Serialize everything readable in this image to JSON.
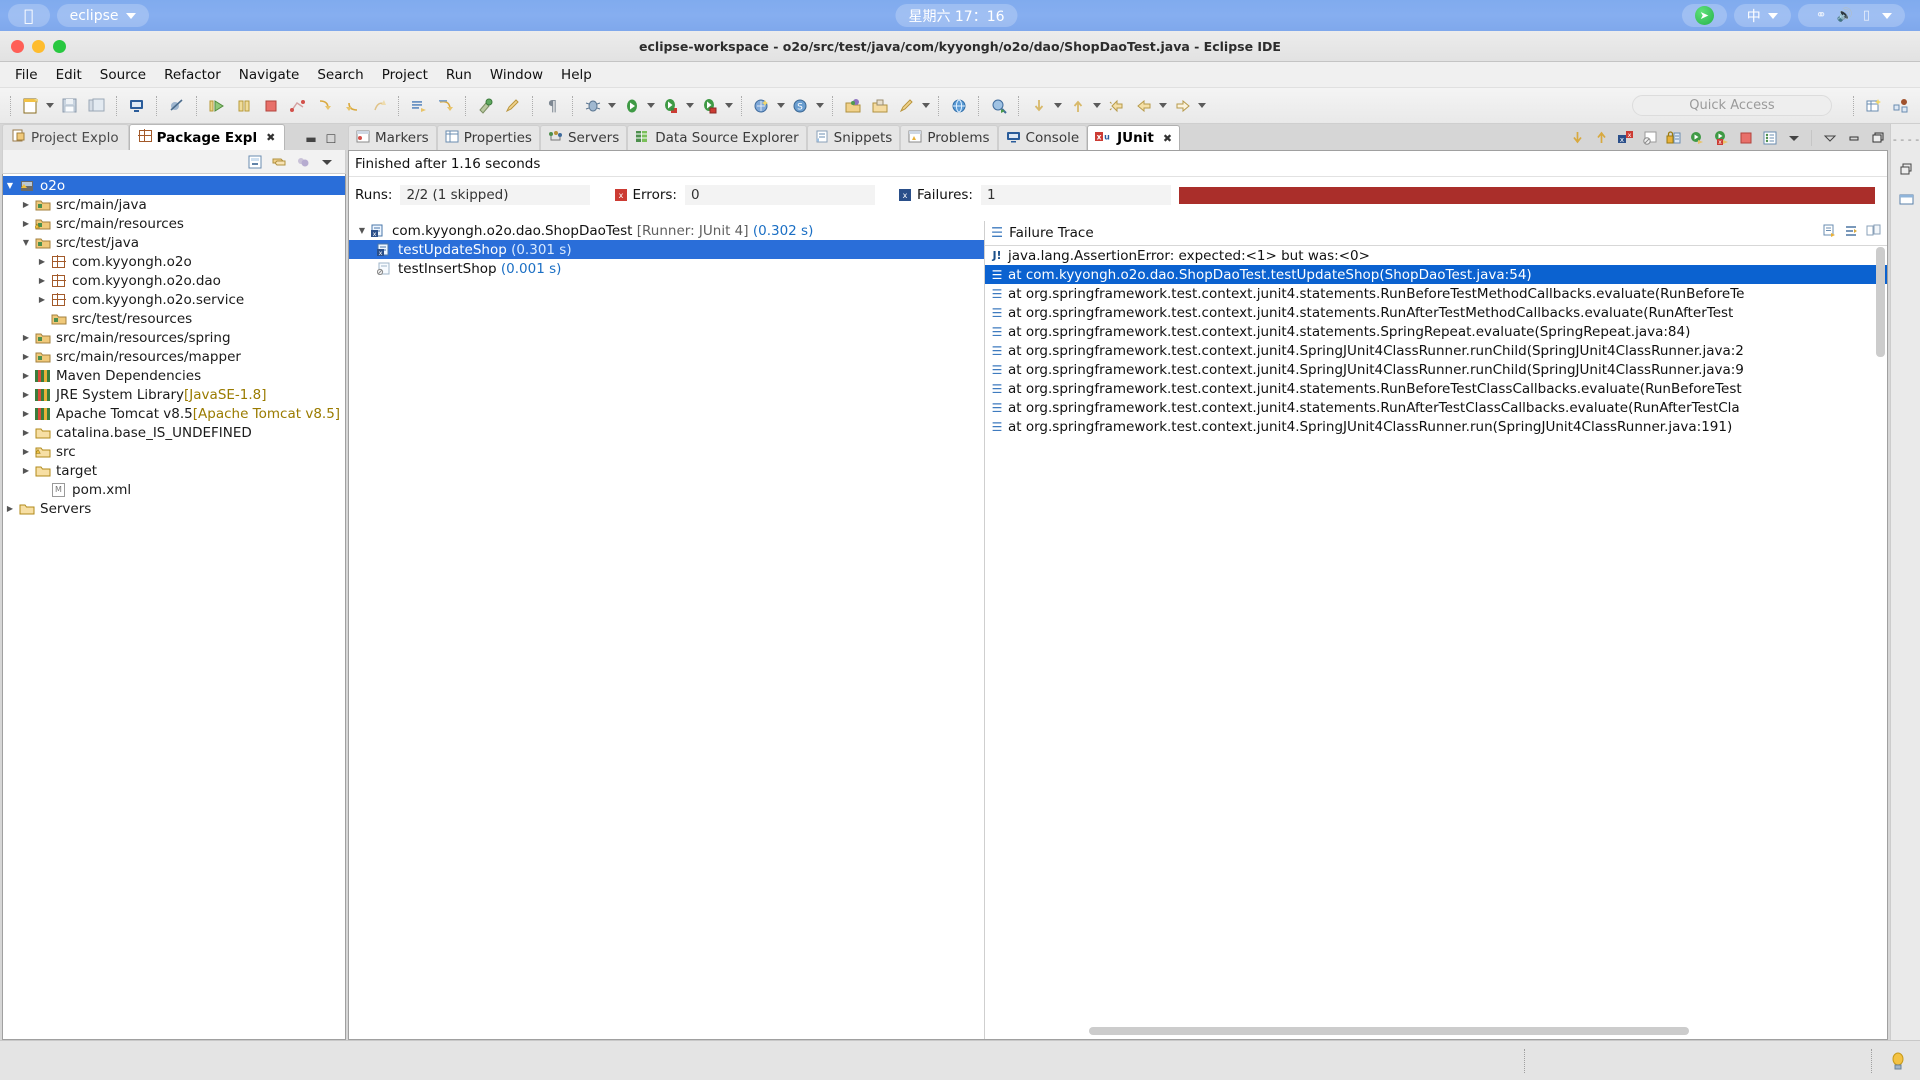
{
  "macbar": {
    "apple_icon": "apple-icon",
    "app_name": "eclipse",
    "clock": "星期六 17：16",
    "telegram_icon": "telegram-icon",
    "ime_label": "中",
    "bluetooth_icon": "bluetooth-icon",
    "volume_icon": "volume-icon",
    "battery_icon": "battery-icon"
  },
  "window": {
    "title": "eclipse-workspace - o2o/src/test/java/com/kyyongh/o2o/dao/ShopDaoTest.java - Eclipse IDE"
  },
  "menu": {
    "items": [
      "File",
      "Edit",
      "Source",
      "Refactor",
      "Navigate",
      "Search",
      "Project",
      "Run",
      "Window",
      "Help"
    ]
  },
  "toolbar": {
    "quick_access_placeholder": "Quick Access",
    "icons": [
      "new-file-icon",
      "new-dropdown-icon",
      "save-icon",
      "save-all-icon",
      "print-icon",
      "toggle-breakpoint-icon",
      "resume-icon",
      "suspend-icon",
      "terminate-icon",
      "disconnect-icon",
      "step-into-icon",
      "step-over-icon",
      "step-return-icon",
      "skip-breakpoints-icon",
      "drop-to-frame-icon",
      "coverage-icon",
      "external-tools-icon",
      "paragraph-icon",
      "debug-icon",
      "debug-dropdown-icon",
      "run-icon",
      "run-dropdown-icon",
      "run-as-icon",
      "run-as-dropdown-icon",
      "run-config-icon",
      "run-config-dropdown-icon",
      "new-java-project-icon",
      "new-java-project-dropdown-icon",
      "new-class-icon",
      "new-class-dropdown-icon",
      "open-type-icon",
      "open-task-icon",
      "pencil-icon",
      "pencil-dropdown-icon",
      "web-browser-icon",
      "search-java-icon",
      "next-annotation-icon",
      "next-annotation-dropdown-icon",
      "previous-annotation-icon",
      "previous-annotation-dropdown-icon",
      "last-edit-icon",
      "back-icon",
      "back-dropdown-icon",
      "forward-icon",
      "forward-dropdown-icon"
    ],
    "right_icons": [
      "open-perspective-icon",
      "java-perspective-icon"
    ]
  },
  "left_panel": {
    "tabs": [
      {
        "label": "Project Explo",
        "icon": "project-explorer-icon",
        "active": false
      },
      {
        "label": "Package Expl",
        "icon": "package-explorer-icon",
        "active": true,
        "closable": true
      }
    ],
    "tab_controls": [
      "minimize-icon",
      "maximize-icon"
    ],
    "view_toolbar_icons": [
      "collapse-all-icon",
      "link-with-editor-icon",
      "focus-on-active-task-icon",
      "view-menu-icon"
    ],
    "tree": [
      {
        "label": "o2o",
        "indent": 0,
        "twisty": "down",
        "icon": "java-project-warning-icon",
        "selected": true
      },
      {
        "label": "src/main/java",
        "indent": 1,
        "twisty": "right",
        "icon": "source-folder-icon"
      },
      {
        "label": "src/main/resources",
        "indent": 1,
        "twisty": "right",
        "icon": "source-folder-warning-icon"
      },
      {
        "label": "src/test/java",
        "indent": 1,
        "twisty": "down",
        "icon": "source-folder-icon"
      },
      {
        "label": "com.kyyongh.o2o",
        "indent": 2,
        "twisty": "right",
        "icon": "package-icon"
      },
      {
        "label": "com.kyyongh.o2o.dao",
        "indent": 2,
        "twisty": "right",
        "icon": "package-icon"
      },
      {
        "label": "com.kyyongh.o2o.service",
        "indent": 2,
        "twisty": "right",
        "icon": "package-icon"
      },
      {
        "label": "src/test/resources",
        "indent": 1,
        "twisty": "none",
        "icon": "source-folder-icon"
      },
      {
        "label": "src/main/resources/spring",
        "indent": 1,
        "twisty": "right",
        "icon": "source-folder-icon"
      },
      {
        "label": "src/main/resources/mapper",
        "indent": 1,
        "twisty": "right",
        "icon": "source-folder-icon"
      },
      {
        "label": "Maven Dependencies",
        "indent": 1,
        "twisty": "right",
        "icon": "library-icon"
      },
      {
        "label": "JRE System Library ",
        "suffix": "[JavaSE-1.8]",
        "indent": 1,
        "twisty": "right",
        "icon": "library-icon"
      },
      {
        "label": "Apache Tomcat v8.5 ",
        "suffix": "[Apache Tomcat v8.5]",
        "indent": 1,
        "twisty": "right",
        "icon": "library-icon"
      },
      {
        "label": "catalina.base_IS_UNDEFINED",
        "indent": 1,
        "twisty": "right",
        "icon": "folder-icon"
      },
      {
        "label": "src",
        "indent": 1,
        "twisty": "right",
        "icon": "folder-warning-icon"
      },
      {
        "label": "target",
        "indent": 1,
        "twisty": "right",
        "icon": "folder-icon"
      },
      {
        "label": "pom.xml",
        "indent": 1,
        "twisty": "none",
        "icon": "maven-pom-icon"
      },
      {
        "label": "Servers",
        "indent": 0,
        "twisty": "right",
        "icon": "folder-icon"
      }
    ]
  },
  "main_panel": {
    "tabs": [
      {
        "label": "Markers",
        "icon": "markers-icon",
        "active": false
      },
      {
        "label": "Properties",
        "icon": "properties-icon",
        "active": false
      },
      {
        "label": "Servers",
        "icon": "servers-icon",
        "active": false
      },
      {
        "label": "Data Source Explorer",
        "icon": "data-source-explorer-icon",
        "active": false
      },
      {
        "label": "Snippets",
        "icon": "snippets-icon",
        "active": false
      },
      {
        "label": "Problems",
        "icon": "problems-icon",
        "active": false
      },
      {
        "label": "Console",
        "icon": "console-icon",
        "active": false
      },
      {
        "label": "JUnit",
        "icon": "junit-icon",
        "active": true,
        "closable": true
      }
    ],
    "tab_toolbar_icons": [
      "next-failure-icon",
      "previous-failure-icon",
      "show-failures-only-icon",
      "show-ignored-icon",
      "lock-icon",
      "rerun-test-icon",
      "rerun-failed-icon",
      "stop-icon",
      "test-run-history-icon",
      "view-menu-icon",
      "minimize-icon",
      "maximize-icon"
    ]
  },
  "junit": {
    "status": "Finished after 1.16 seconds",
    "runs_label": "Runs:",
    "runs_value": "2/2 (1 skipped)",
    "errors_label": "Errors:",
    "errors_value": "0",
    "failures_label": "Failures:",
    "failures_value": "1",
    "progress_color": "#aa2e2a",
    "tests": [
      {
        "name": "com.kyyongh.o2o.dao.ShopDaoTest",
        "runner": "[Runner: JUnit 4]",
        "time": "(0.302 s)",
        "indent": 0,
        "twisty": "down",
        "icon": "test-class-failed-icon",
        "selected": false
      },
      {
        "name": "testUpdateShop",
        "runner": "",
        "time": "(0.301 s)",
        "indent": 1,
        "twisty": "none",
        "icon": "test-failed-icon",
        "selected": true
      },
      {
        "name": "testInsertShop",
        "runner": "",
        "time": "(0.001 s)",
        "indent": 1,
        "twisty": "none",
        "icon": "test-skipped-icon",
        "selected": false
      }
    ],
    "failure_trace": {
      "title": "Failure Trace",
      "header_icons": [
        "copy-trace-icon",
        "filter-stack-trace-icon",
        "compare-result-icon"
      ],
      "lines": [
        {
          "text": "java.lang.AssertionError: expected:<1> but was:<0>",
          "icon": "exception-icon",
          "selected": false
        },
        {
          "text": "at com.kyyongh.o2o.dao.ShopDaoTest.testUpdateShop(ShopDaoTest.java:54)",
          "icon": "stack-frame-icon",
          "selected": true
        },
        {
          "text": "at org.springframework.test.context.junit4.statements.RunBeforeTestMethodCallbacks.evaluate(RunBeforeTe",
          "icon": "stack-frame-icon",
          "selected": false
        },
        {
          "text": "at org.springframework.test.context.junit4.statements.RunAfterTestMethodCallbacks.evaluate(RunAfterTest",
          "icon": "stack-frame-icon",
          "selected": false
        },
        {
          "text": "at org.springframework.test.context.junit4.statements.SpringRepeat.evaluate(SpringRepeat.java:84)",
          "icon": "stack-frame-icon",
          "selected": false
        },
        {
          "text": "at org.springframework.test.context.junit4.SpringJUnit4ClassRunner.runChild(SpringJUnit4ClassRunner.java:2",
          "icon": "stack-frame-icon",
          "selected": false
        },
        {
          "text": "at org.springframework.test.context.junit4.SpringJUnit4ClassRunner.runChild(SpringJUnit4ClassRunner.java:9",
          "icon": "stack-frame-icon",
          "selected": false
        },
        {
          "text": "at org.springframework.test.context.junit4.statements.RunBeforeTestClassCallbacks.evaluate(RunBeforeTest",
          "icon": "stack-frame-icon",
          "selected": false
        },
        {
          "text": "at org.springframework.test.context.junit4.statements.RunAfterTestClassCallbacks.evaluate(RunAfterTestCla",
          "icon": "stack-frame-icon",
          "selected": false
        },
        {
          "text": "at org.springframework.test.context.junit4.SpringJUnit4ClassRunner.run(SpringJUnit4ClassRunner.java:191)",
          "icon": "stack-frame-icon",
          "selected": false
        }
      ]
    }
  },
  "right_strip": {
    "icons": [
      "restore-icon",
      "java-perspective-icon"
    ]
  },
  "status_bar": {
    "tip_icon": "lightbulb-icon"
  }
}
